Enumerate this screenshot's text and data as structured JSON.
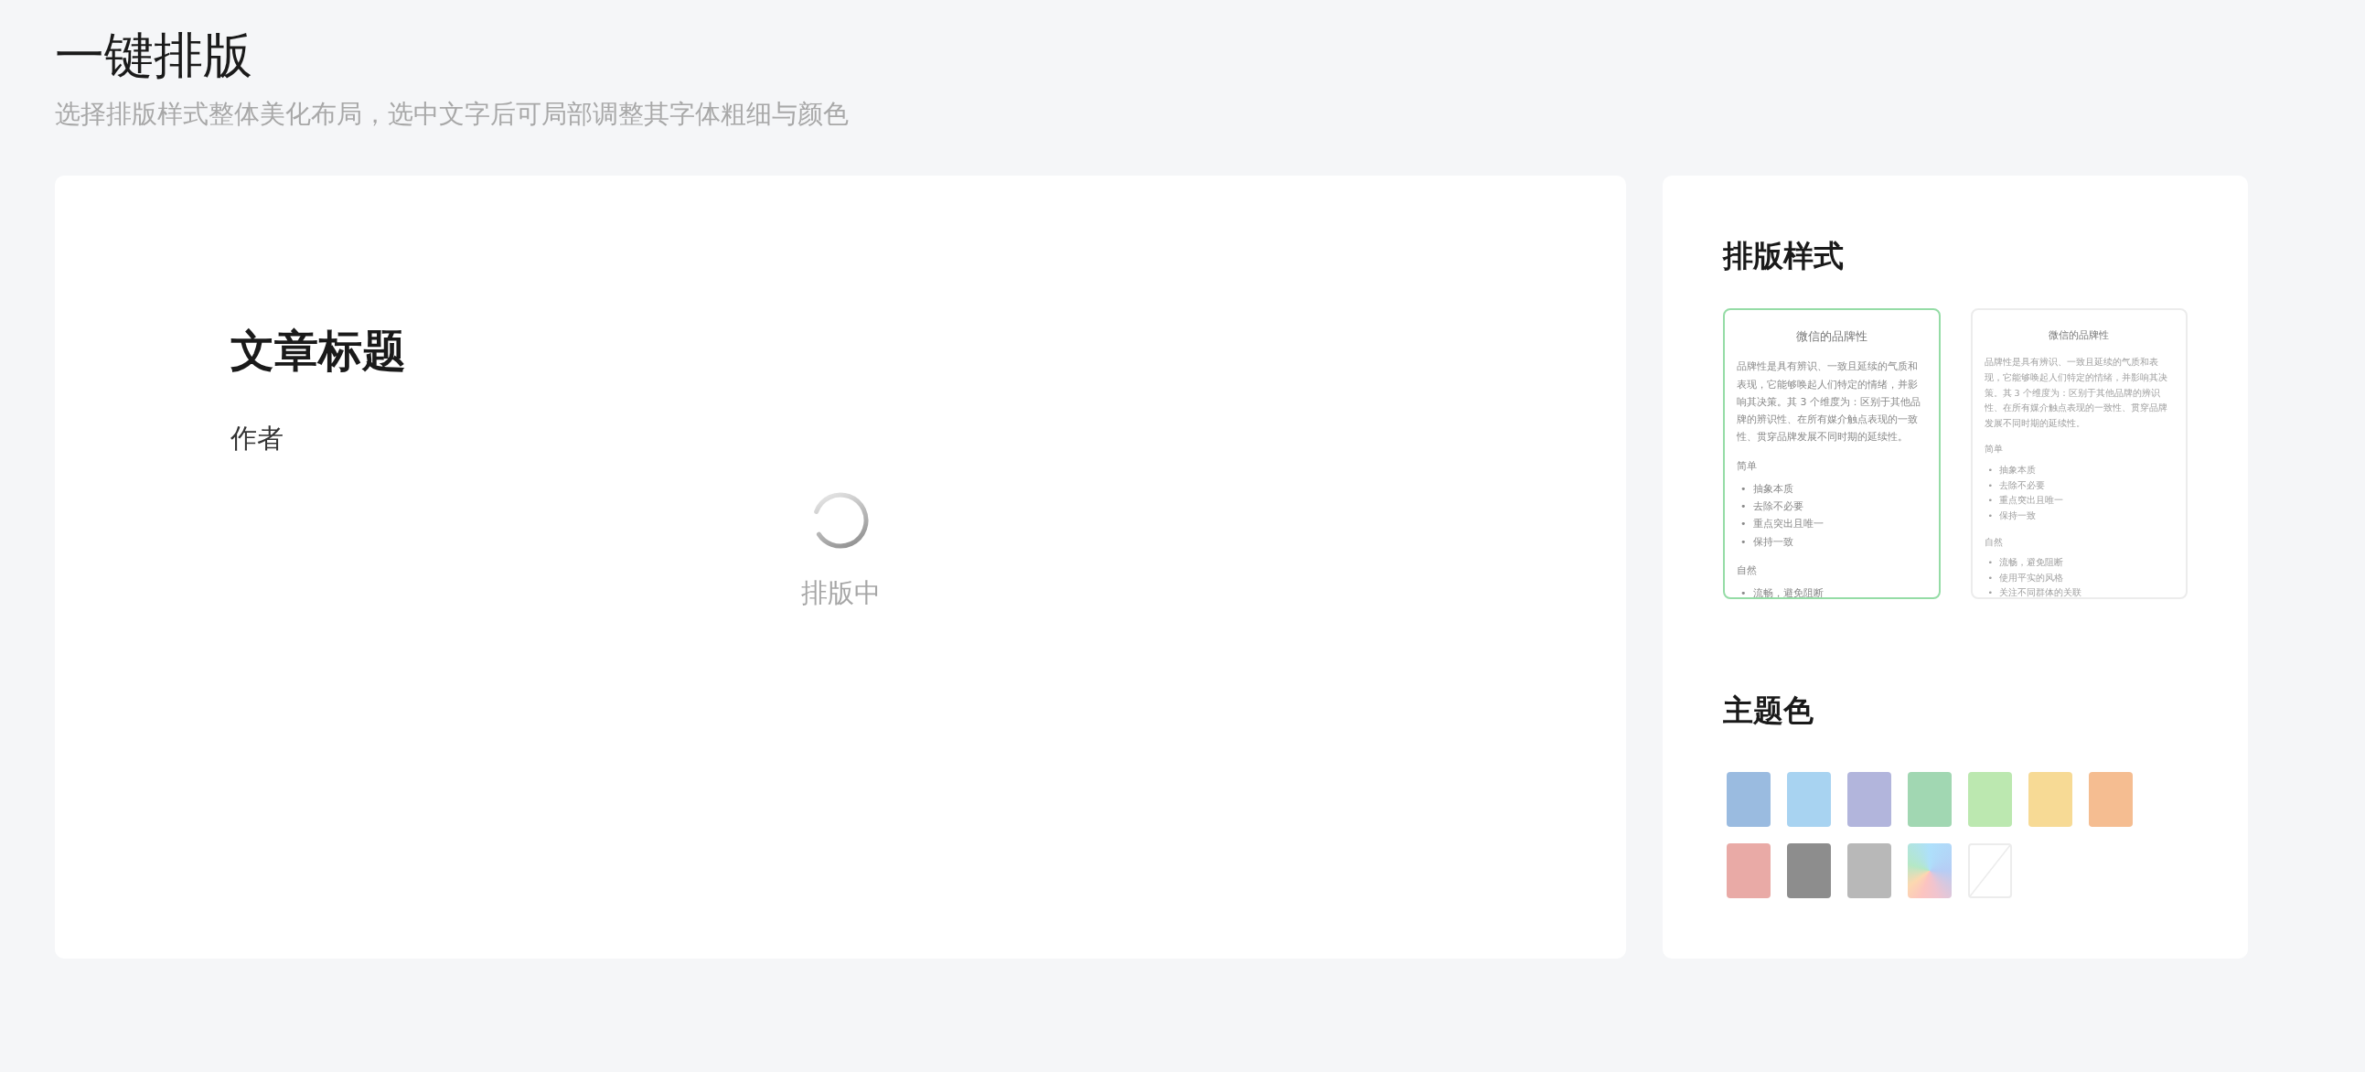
{
  "page": {
    "title": "一键排版",
    "subtitle": "选择排版样式整体美化布局，选中文字后可局部调整其字体粗细与颜色"
  },
  "editor": {
    "article_title": "文章标题",
    "author": "作者",
    "status": "排版中"
  },
  "styles_panel": {
    "heading": "排版样式",
    "templates": [
      {
        "selected": true,
        "kind": "regular",
        "bullet": "•",
        "title": "微信的品牌性",
        "intro": "品牌性是具有辨识、一致且延续的气质和表现，它能够唤起人们特定的情绪，并影响其决策。其 3 个维度为：区别于其他品牌的辨识性、在所有媒介触点表现的一致性、贯穿品牌发展不同时期的延续性。",
        "sections": [
          {
            "heading": "简单",
            "items": [
              "抽象本质",
              "去除不必要",
              "重点突出且唯一",
              "保持一致"
            ]
          },
          {
            "heading": "自然",
            "items": [
              "流畅，避免阻断"
            ]
          }
        ]
      },
      {
        "selected": false,
        "kind": "compact",
        "bullet": "•",
        "title": "微信的品牌性",
        "intro": "品牌性是具有辨识、一致且延续的气质和表现，它能够唤起人们特定的情绪，并影响其决策。其 3 个维度为：区别于其他品牌的辨识性、在所有媒介触点表现的一致性、贯穿品牌发展不同时期的延续性。",
        "sections": [
          {
            "heading": "简单",
            "items": [
              "抽象本质",
              "去除不必要",
              "重点突出且唯一",
              "保持一致"
            ]
          },
          {
            "heading": "自然",
            "items": [
              "流畅，避免阻断",
              "使用平实的风格",
              "关注不同群体的关联"
            ]
          }
        ]
      }
    ]
  },
  "theme_panel": {
    "heading": "主题色",
    "swatches": [
      {
        "kind": "solid",
        "color": "#9abbe0"
      },
      {
        "kind": "solid",
        "color": "#a8d3f1"
      },
      {
        "kind": "solid",
        "color": "#b2b5dc"
      },
      {
        "kind": "solid",
        "color": "#a1d7b2"
      },
      {
        "kind": "solid",
        "color": "#bce8b0"
      },
      {
        "kind": "solid",
        "color": "#f7da95"
      },
      {
        "kind": "solid",
        "color": "#f5bd91"
      },
      {
        "kind": "solid",
        "color": "#e9aaa6"
      },
      {
        "kind": "solid",
        "color": "#8d8d8d"
      },
      {
        "kind": "solid",
        "color": "#b8b8b8"
      },
      {
        "kind": "gradient"
      },
      {
        "kind": "none"
      }
    ]
  }
}
